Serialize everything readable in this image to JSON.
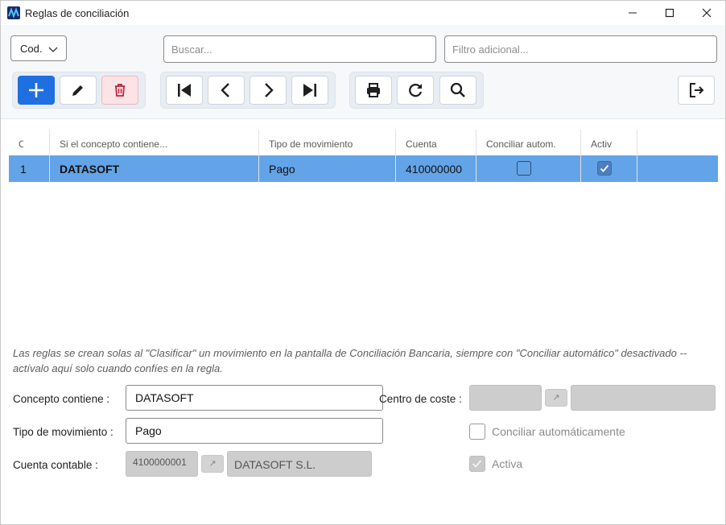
{
  "window": {
    "title": "Reglas de conciliación"
  },
  "toolbar": {
    "code_select": "Cod.",
    "search_placeholder": "Buscar...",
    "filter_placeholder": "Filtro adicional..."
  },
  "grid": {
    "headers": [
      "C",
      "Si el concepto contiene...",
      "Tipo de movimiento",
      "Cuenta",
      "Conciliar autom.",
      "Activ"
    ],
    "rows": [
      {
        "code": "1",
        "concept": "DATASOFT",
        "type": "Pago",
        "account": "410000000",
        "auto": false,
        "active": true
      }
    ]
  },
  "note": "Las reglas se crean solas al \"Clasificar\" un movimiento en la pantalla de Conciliación Bancaria, siempre con \"Conciliar automático\" desactivado -- actívalo aquí solo cuando confíes en la regla.",
  "form": {
    "concept_label": "Concepto contiene :",
    "concept_value": "DATASOFT",
    "type_label": "Tipo de movimiento :",
    "type_value": "Pago",
    "account_label": "Cuenta contable :",
    "account_code": "4100000001",
    "account_name": "DATASOFT S.L.",
    "cost_center_label": "Centro de coste :",
    "auto_label": "Conciliar automáticamente",
    "auto_checked": false,
    "active_label": "Activa",
    "active_checked": true
  },
  "colors": {
    "primary": "#1f6fe0",
    "selection": "#63a4e8",
    "danger": "#c0243c"
  }
}
